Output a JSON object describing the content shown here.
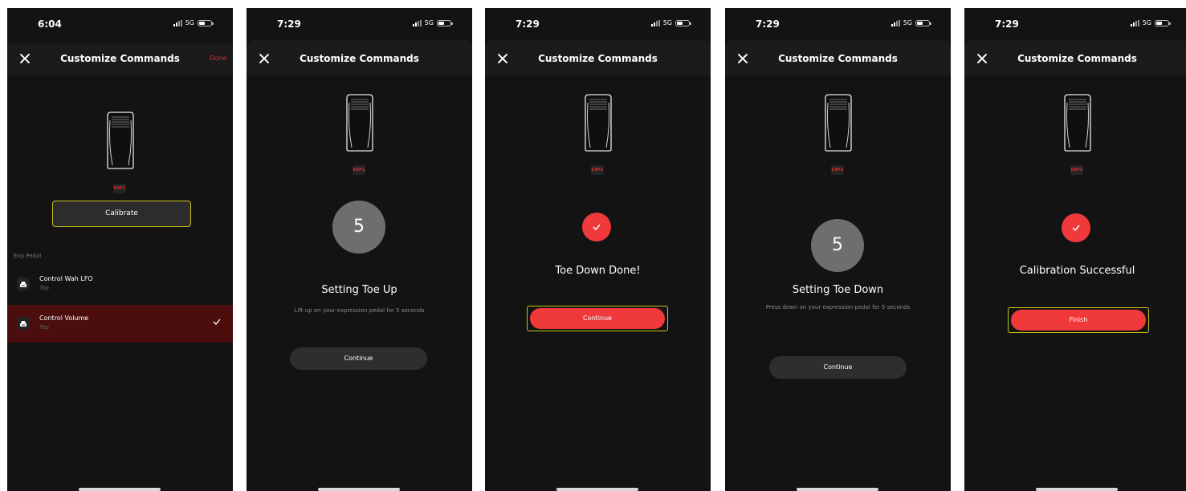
{
  "common": {
    "title": "Customize Commands",
    "network": "5G",
    "badge": "EXP1"
  },
  "screens": [
    {
      "time": "6:04",
      "done_label": "Done",
      "calibrate_label": "Calibrate",
      "section_label": "Exp Pedal",
      "items": [
        {
          "title": "Control Wah LFO",
          "sub": "Top",
          "selected": false
        },
        {
          "title": "Control Volume",
          "sub": "Top",
          "selected": true
        }
      ]
    },
    {
      "time": "7:29",
      "counter": "5",
      "heading": "Setting Toe Up",
      "instruction": "Lift up on your expression pedal for 5 seconds",
      "button_label": "Continue"
    },
    {
      "time": "7:29",
      "heading": "Toe Down Done!",
      "button_label": "Continue"
    },
    {
      "time": "7:29",
      "counter": "5",
      "heading": "Setting Toe Down",
      "instruction": "Press down on your expression pedal for 5 seconds",
      "button_label": "Continue"
    },
    {
      "time": "7:29",
      "heading": "Calibration Successful",
      "button_label": "Finish"
    }
  ]
}
